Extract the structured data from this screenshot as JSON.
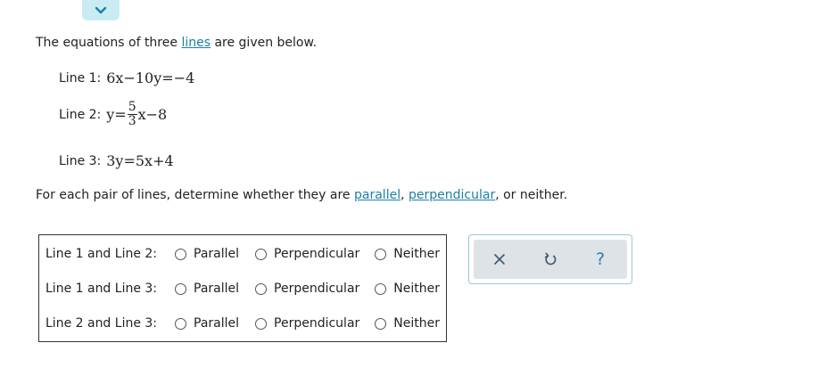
{
  "colors": {
    "link": "#1b7fa8",
    "collapse_tab_bg": "#c9ecf3",
    "toolbar_bg": "#dde3e7",
    "toolbar_border": "#9cc9d6"
  },
  "collapse_button": {
    "icon": "chevron-down-icon"
  },
  "intro": {
    "before": "The equations of three ",
    "link": "lines",
    "after": " are given below."
  },
  "equations": {
    "line1": {
      "label": "Line 1:",
      "math": "6x−10y=−4"
    },
    "line2": {
      "label": "Line 2:",
      "prefix": "y=",
      "numerator": "5",
      "denominator": "3",
      "suffix": "x−8"
    },
    "line3": {
      "label": "Line 3:",
      "math": "3y=5x+4"
    }
  },
  "question": {
    "before": "For each pair of lines, determine whether they are ",
    "link1": "parallel",
    "comma": ", ",
    "link2": "perpendicular",
    "after": ", or neither."
  },
  "pairs": [
    {
      "label": "Line 1 and Line 2:",
      "options": [
        "Parallel",
        "Perpendicular",
        "Neither"
      ],
      "selected": null
    },
    {
      "label": "Line 1 and Line 3:",
      "options": [
        "Parallel",
        "Perpendicular",
        "Neither"
      ],
      "selected": null
    },
    {
      "label": "Line 2 and Line 3:",
      "options": [
        "Parallel",
        "Perpendicular",
        "Neither"
      ],
      "selected": null
    }
  ],
  "toolbar": {
    "clear_icon": "close-icon",
    "undo_icon": "undo-icon",
    "help_label": "?"
  }
}
